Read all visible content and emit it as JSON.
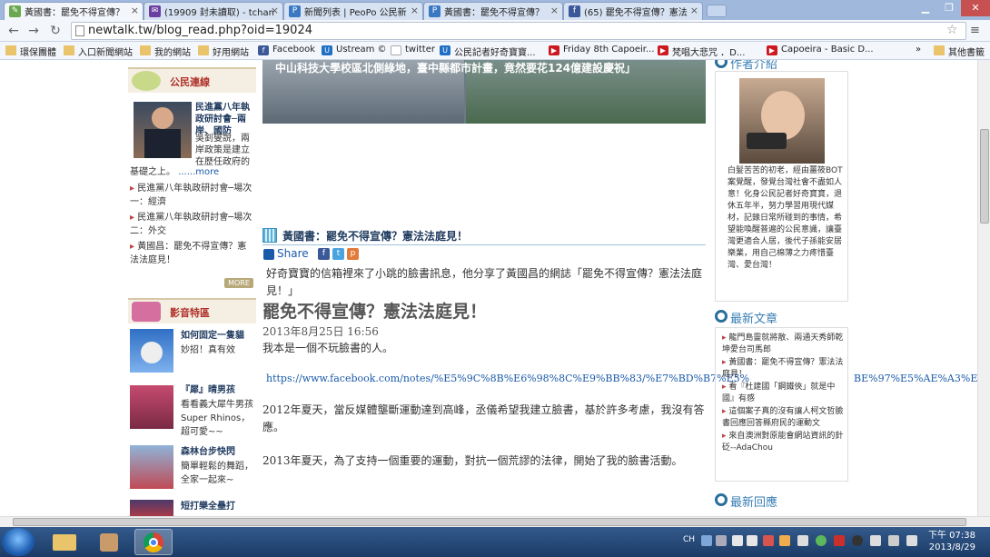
{
  "browser": {
    "tabs": [
      {
        "label": "黃國書：罷免不得宣傳？",
        "favicon": "newtalk"
      },
      {
        "label": "(19909 封未讀取) - tchan",
        "favicon": "yahoo-mail"
      },
      {
        "label": "新聞列表 | PeoPo 公民新",
        "favicon": "peopo"
      },
      {
        "label": "黃國書：罷免不得宣傳？",
        "favicon": "peopo"
      },
      {
        "label": "(65) 罷免不得宣傳？憲法",
        "favicon": "facebook"
      }
    ],
    "url": "newtalk.tw/blog_read.php?oid=19024",
    "bookmarks": [
      {
        "label": "環保團體",
        "icon": "folder"
      },
      {
        "label": "入口新聞網站",
        "icon": "folder"
      },
      {
        "label": "我的網站",
        "icon": "folder"
      },
      {
        "label": "好用網站",
        "icon": "folder"
      },
      {
        "label": "Facebook",
        "icon": "facebook"
      },
      {
        "label": "Ustream ©",
        "icon": "ustream"
      },
      {
        "label": "twitter",
        "icon": "blank"
      },
      {
        "label": "公民記者好奇寶寶...",
        "icon": "ustream"
      },
      {
        "label": "Friday 8th Capoeir...",
        "icon": "youtube"
      },
      {
        "label": "梵唱大悲咒 ．D...",
        "icon": "youtube"
      },
      {
        "label": "Capoeira - Basic D...",
        "icon": "youtube"
      }
    ],
    "bookmarks_overflow": "»",
    "other_bookmarks": "其他書籤"
  },
  "left": {
    "citizen_link": {
      "title": "公民連線",
      "feature_title": "民進黨八年執政研討會─兩岸、國防",
      "feature_summary": "吳釗燮說，兩岸政策是建立在歷任政府的基礎之上。",
      "more_link": "......more",
      "items": [
        "民進黨八年執政研討會─場次一：經濟",
        "民進黨八年執政研討會─場次二：外交",
        "黃國昌：罷免不得宣傳？憲法法庭見！"
      ],
      "more_button": "MORE"
    },
    "video": {
      "title": "影音特區",
      "items": [
        {
          "title": "如何固定一隻貓",
          "desc": "妙招！真有效"
        },
        {
          "title": "『犀』晴男孩",
          "desc": "看看義大犀牛男孩Super Rhinos，超可愛~~"
        },
        {
          "title": "森林台步快閃",
          "desc": "簡單輕鬆的舞蹈，全家一起來~"
        },
        {
          "title": "短打樂全壘打",
          "desc": ""
        }
      ]
    }
  },
  "main": {
    "banner_caption": "中山科技大學校區北側綠地，臺中縣都市計畫，竟然要花124億建設慶祝」",
    "headline": "黃國書：罷免不得宣傳？憲法法庭見！",
    "share_label": "Share",
    "intro": "好奇寶寶的信箱裡來了小跳的臉書訊息，他分享了黃國昌的網誌「罷免不得宣傳？憲法法庭見！」",
    "title": "罷免不得宣傳？憲法法庭見！",
    "date": "2013年8月25日 16:56",
    "p1": "我本是一個不玩臉書的人。",
    "url_text": "https://www.facebook.com/notes/%E5%9C%8B%E6%98%8C%E9%BB%83/%E7%BD%B7%E5%",
    "url_text_tail": "BE%97%E5%AE%A3%E5",
    "p2": "2012年夏天，當反媒體壟斷運動達到高峰，丞儀希望我建立臉書，基於許多考慮，我沒有答應。",
    "p3": "2013年夏天，為了支持一個重要的運動，對抗一個荒謬的法律，開始了我的臉書活動。"
  },
  "right": {
    "author": {
      "title": "作者介紹",
      "bio": "白髮苦苦的初老，經由薑筱BOT案覺醒，發覺台灣社會不盡如人意！化身公民記者好奇寶寶，退休五年半，努力學習用現代媒材，記錄日常所碰到的事情，希望能喚醒普遍的公民意識，讓臺灣更適合人居，後代子孫能安居樂業，用自己棉薄之力疼惜臺灣、愛台灣！"
    },
    "latest": {
      "title": "最新文章",
      "items": [
        "龍門島靈就將散、兩通天秀師乾坤愛台司馬郎",
        "黃國書：罷免不得宣傳？憲法法庭見！",
        "看『杜建國「鋼鐵俠」就是中國』有感",
        "這個案子真的沒有讓人柯文哲臉書回應回答縣府民的運動文",
        "來自澳洲對原能會網站資訊的針砭--AdaChou"
      ]
    },
    "latest_replies": {
      "title": "最新回應"
    }
  },
  "taskbar": {
    "lang": "CH",
    "time": "下午 07:38",
    "date": "2013/8/29"
  }
}
